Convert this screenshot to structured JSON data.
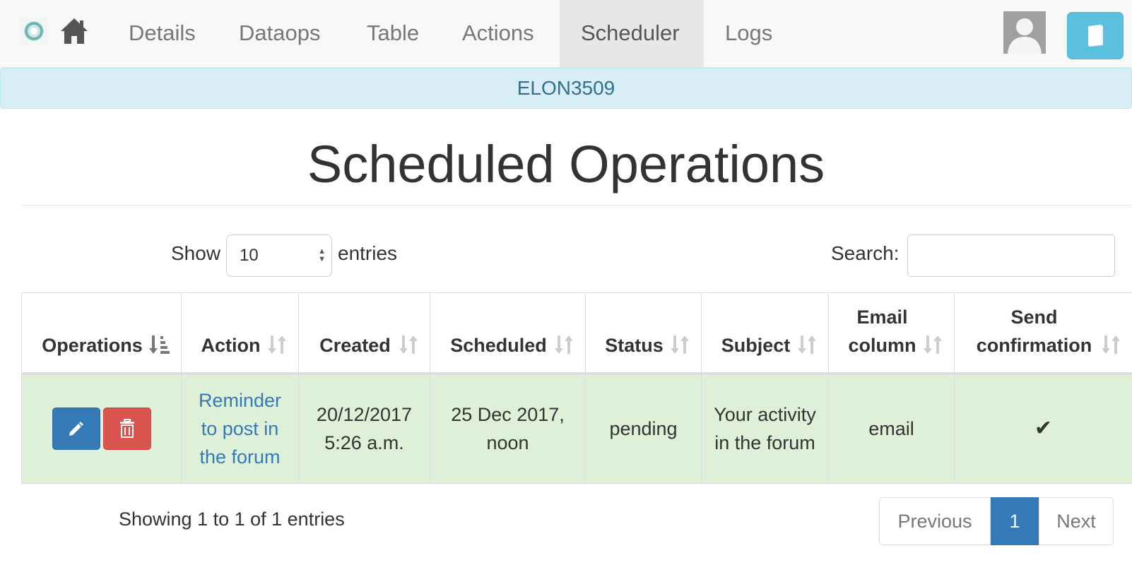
{
  "navbar": {
    "items": [
      {
        "label": "Details"
      },
      {
        "label": "Dataops"
      },
      {
        "label": "Table"
      },
      {
        "label": "Actions"
      },
      {
        "label": "Scheduler",
        "active": true
      },
      {
        "label": "Logs"
      }
    ],
    "icons": [
      "logo-icon",
      "home-icon",
      "avatar",
      "book-icon"
    ]
  },
  "banner": {
    "text": "ELON3509"
  },
  "page": {
    "title": "Scheduled Operations"
  },
  "controls": {
    "show_label": "Show",
    "page_length": "10",
    "entries_label": "entries",
    "search_label": "Search:",
    "search_value": ""
  },
  "table": {
    "columns": [
      {
        "label": "Operations"
      },
      {
        "label": "Action"
      },
      {
        "label": "Created"
      },
      {
        "label": "Scheduled"
      },
      {
        "label": "Status"
      },
      {
        "label": "Subject"
      },
      {
        "label": "Email column"
      },
      {
        "label": "Send confirmation"
      }
    ],
    "sorted_column": "Operations",
    "rows": [
      {
        "action": "Reminder to post in the forum",
        "created": "20/12/2017 5:26 a.m.",
        "scheduled": "25 Dec 2017, noon",
        "status": "pending",
        "subject": "Your activity in the forum",
        "email_column": "email",
        "send_confirmation": "✔"
      }
    ]
  },
  "footer": {
    "info": "Showing 1 to 1 of 1 entries",
    "previous": "Previous",
    "current_page": "1",
    "next": "Next"
  },
  "colors": {
    "primary": "#337ab7",
    "danger": "#d9534f",
    "info": "#5bc0de",
    "row_success": "#dff0d8",
    "banner_bg": "#d9edf7",
    "banner_text": "#31708f"
  }
}
